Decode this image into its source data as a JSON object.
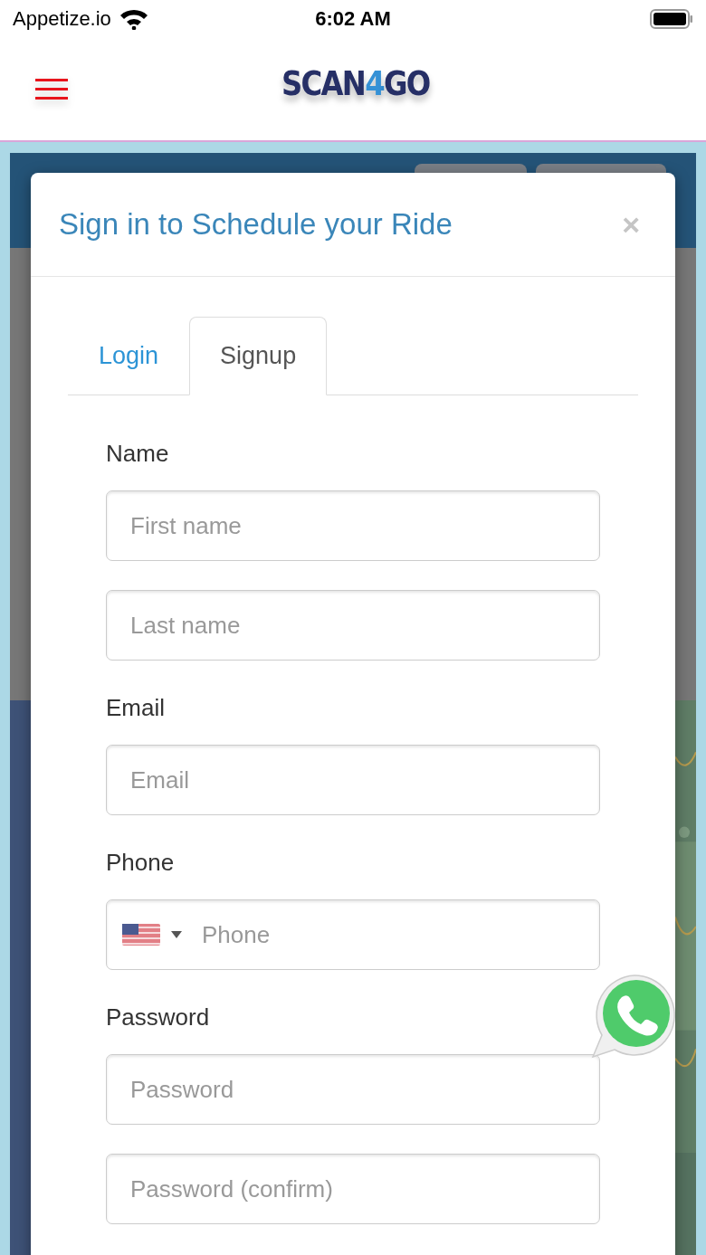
{
  "status_bar": {
    "carrier": "Appetize.io",
    "time": "6:02 AM"
  },
  "header": {
    "logo": [
      "SCAN",
      "4",
      "GO"
    ]
  },
  "modal": {
    "title": "Sign in to Schedule your Ride",
    "close": "×",
    "tabs": [
      {
        "label": "Login",
        "selected": false
      },
      {
        "label": "Signup",
        "selected": true
      }
    ],
    "fields": [
      {
        "label": "Name",
        "inputs": [
          {
            "kind": "text",
            "placeholder": "First name"
          },
          {
            "kind": "text",
            "placeholder": "Last name"
          }
        ]
      },
      {
        "label": "Email",
        "inputs": [
          {
            "kind": "text",
            "placeholder": "Email"
          }
        ]
      },
      {
        "label": "Phone",
        "inputs": [
          {
            "kind": "phone",
            "placeholder": "Phone"
          }
        ]
      },
      {
        "label": "Password",
        "inputs": [
          {
            "kind": "text",
            "placeholder": "Password"
          },
          {
            "kind": "text",
            "placeholder": "Password (confirm)"
          }
        ]
      }
    ]
  }
}
